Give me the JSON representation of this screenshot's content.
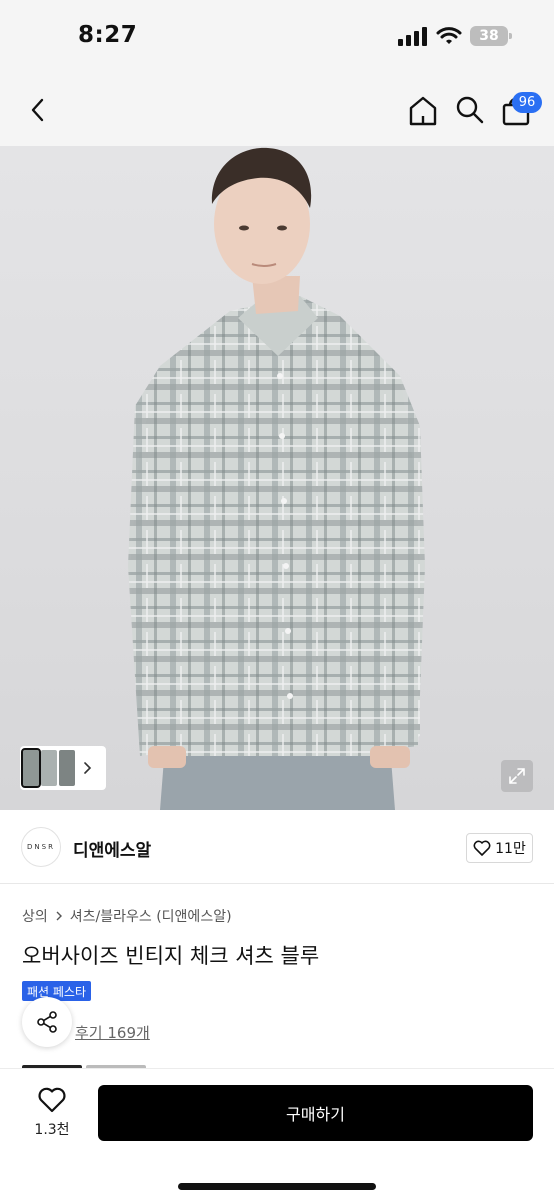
{
  "status_bar": {
    "time": "8:27",
    "battery": "38",
    "icons": [
      "signal-icon",
      "wifi-icon",
      "battery-icon"
    ]
  },
  "nav": {
    "back_icon": "chevron-left-icon",
    "home_icon": "home-icon",
    "search_icon": "search-icon",
    "cart_icon": "shopping-bag-icon",
    "cart_count": "96"
  },
  "gallery": {
    "thumbnail_count": 3,
    "expand_icon": "expand-icon"
  },
  "brand": {
    "logo_text": "DNSR",
    "name": "디앤에스알",
    "likes": "11만"
  },
  "product": {
    "breadcrumb": [
      "상의",
      "셔츠/블라우스 (디앤에스알)"
    ],
    "title": "오버사이즈 빈티지 체크 셔츠 블루",
    "promo_badge": "패션 페스타",
    "review_link": "후기 169개"
  },
  "bottom_bar": {
    "wish_count": "1.3천",
    "buy_label": "구매하기"
  },
  "colors": {
    "accent": "#2a6ff3",
    "promo": "#2a62e8",
    "buy_button": "#000000"
  }
}
